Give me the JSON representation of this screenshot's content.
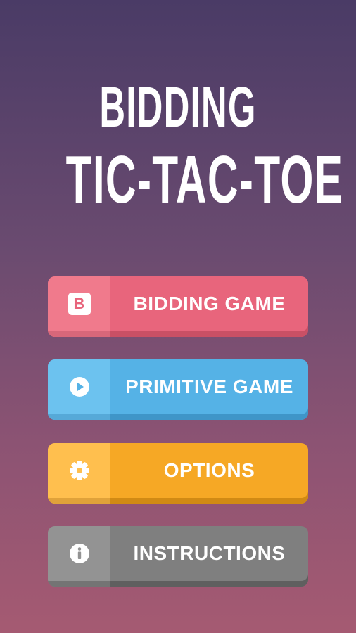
{
  "title": {
    "line1": "BIDDING",
    "line2": "TIC-TAC-TOE"
  },
  "menu": {
    "bidding_game": {
      "label": "BIDDING GAME",
      "icon": "b-letter-icon",
      "icon_text": "B",
      "color": "#e8657c"
    },
    "primitive_game": {
      "label": "PRIMITIVE GAME",
      "icon": "play-icon",
      "color": "#55b2e6"
    },
    "options": {
      "label": "OPTIONS",
      "icon": "gear-icon",
      "color": "#f6a825"
    },
    "instructions": {
      "label": "INSTRUCTIONS",
      "icon": "info-icon",
      "color": "#7f7f7f"
    }
  },
  "colors": {
    "background_top": "#4a3b66",
    "background_bottom": "#a55a72"
  }
}
